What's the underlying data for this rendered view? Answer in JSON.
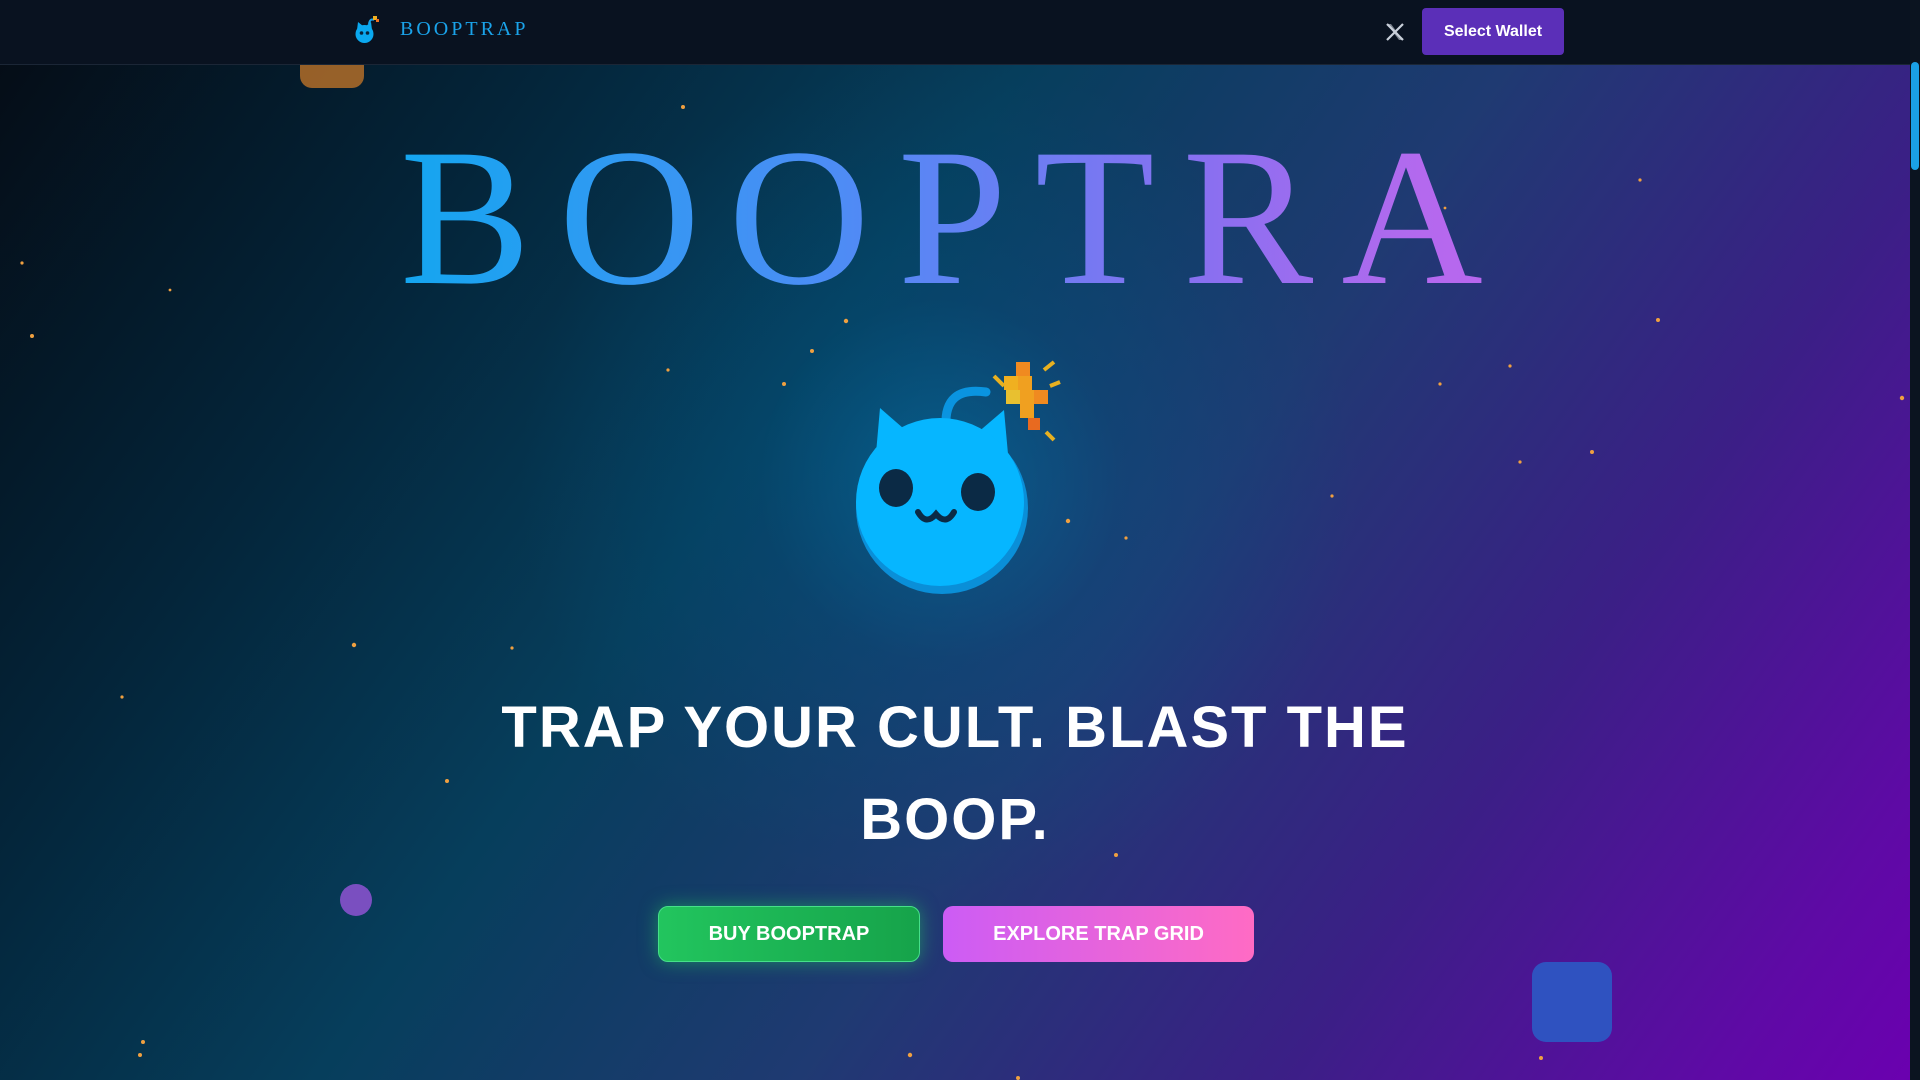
{
  "brand": {
    "name": "BOOPTRAP",
    "accent_color": "#1aa3ea"
  },
  "nav": {
    "x_icon": "x-logo-icon",
    "wallet_button_label": "Select Wallet",
    "wallet_button_color": "#5b2fb8"
  },
  "hero": {
    "title": "BOOPTRAP",
    "mascot_icon": "bomb-cat-mascot",
    "tagline": "TRAP YOUR CULT. BLAST THE BOOP.",
    "buttons": {
      "buy_label": "BUY BOOPTRAP",
      "explore_label": "EXPLORE TRAP GRID"
    }
  },
  "colors": {
    "buy_green": "#22c55e",
    "explore_pink": "#ff6bc4",
    "explore_purple": "#cc5cf5",
    "mascot_blue": "#06b6ff"
  }
}
